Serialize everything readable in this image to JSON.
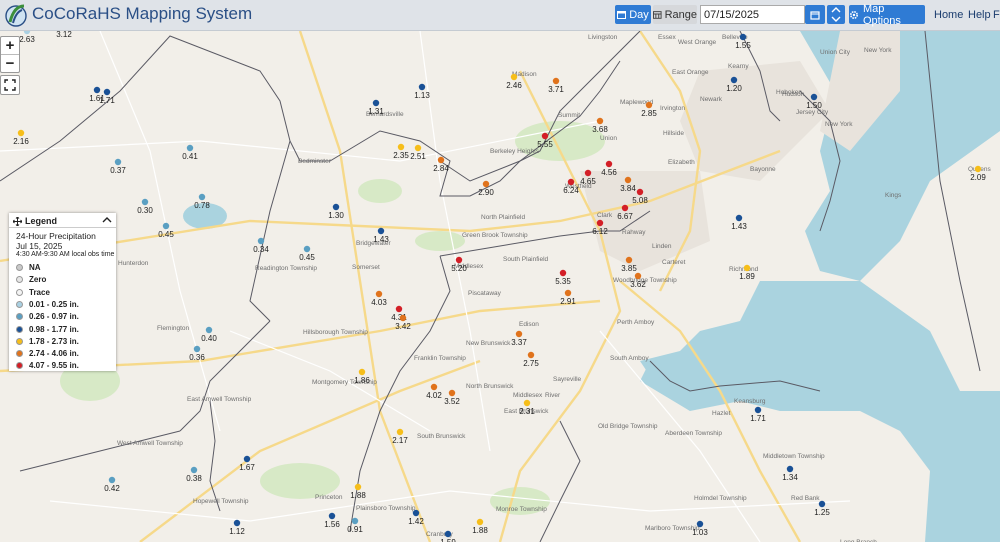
{
  "header": {
    "title": "CoCoRaHS Mapping System",
    "day_label": "Day",
    "range_label": "Range",
    "date_value": "07/15/2025",
    "map_options_label": "Map Options",
    "nav": [
      "Home",
      "Help",
      "Fe"
    ]
  },
  "map": {
    "labels": [
      {
        "t": "Essex"
      },
      {
        "t": "Livingston"
      },
      {
        "t": "West Orange"
      },
      {
        "t": "Belleville"
      },
      {
        "t": "East Orange"
      },
      {
        "t": "Union City"
      },
      {
        "t": "New York"
      },
      {
        "t": "Kearny"
      },
      {
        "t": "Newark"
      },
      {
        "t": "Irvington"
      },
      {
        "t": "Maplewood"
      },
      {
        "t": "Madison"
      },
      {
        "t": "Summit"
      },
      {
        "t": "Hoboken"
      },
      {
        "t": "Hudson"
      },
      {
        "t": "Jersey City"
      },
      {
        "t": "New York"
      },
      {
        "t": "Hillside"
      },
      {
        "t": "Union"
      },
      {
        "t": "Elizabeth"
      },
      {
        "t": "Bayonne"
      },
      {
        "t": "Bernardsville"
      },
      {
        "t": "Bedminster"
      },
      {
        "t": "Berkeley Heights"
      },
      {
        "t": "Westfield"
      },
      {
        "t": "Clark"
      },
      {
        "t": "Rahway"
      },
      {
        "t": "Linden"
      },
      {
        "t": "Kings"
      },
      {
        "t": "Queens"
      },
      {
        "t": "North Plainfield"
      },
      {
        "t": "Green Brook Township"
      },
      {
        "t": "Bridgewater"
      },
      {
        "t": "Somerset"
      },
      {
        "t": "Middlesex"
      },
      {
        "t": "South Plainfield"
      },
      {
        "t": "Hunterdon"
      },
      {
        "t": "Readington Township"
      },
      {
        "t": "Piscataway"
      },
      {
        "t": "Carteret"
      },
      {
        "t": "Woodbridge Township"
      },
      {
        "t": "Richmond"
      },
      {
        "t": "Hillsborough Township"
      },
      {
        "t": "Flemington"
      },
      {
        "t": "Edison"
      },
      {
        "t": "New Brunswick"
      },
      {
        "t": "Perth Amboy"
      },
      {
        "t": "South Amboy"
      },
      {
        "t": "Franklin Township"
      },
      {
        "t": "Sayreville"
      },
      {
        "t": "Montgomery Township"
      },
      {
        "t": "North Brunswick"
      },
      {
        "t": "Middlesex"
      },
      {
        "t": "East Brunswick"
      },
      {
        "t": "Keansburg"
      },
      {
        "t": "Hazlet"
      },
      {
        "t": "East Amwell Township"
      },
      {
        "t": "Old Bridge Township"
      },
      {
        "t": "Aberdeen Township"
      },
      {
        "t": "West Amwell Township"
      },
      {
        "t": "South Brunswick"
      },
      {
        "t": "Middletown Township"
      },
      {
        "t": "Princeton"
      },
      {
        "t": "Holmdel Township"
      },
      {
        "t": "Red Bank"
      },
      {
        "t": "Hopewell Township"
      },
      {
        "t": "Plainsboro Township"
      },
      {
        "t": "Monroe Township"
      },
      {
        "t": "Marlboro Township"
      },
      {
        "t": "Long Branch"
      },
      {
        "t": "Cranbury"
      },
      {
        "t": "River"
      }
    ],
    "stations": [
      {
        "v": "2.63",
        "c": "l1"
      },
      {
        "v": "3.12",
        "c": "o"
      },
      {
        "v": "1.55",
        "c": "d"
      },
      {
        "v": "1.61",
        "c": "d"
      },
      {
        "v": "1.71",
        "c": "d"
      },
      {
        "v": "2.46",
        "c": "y"
      },
      {
        "v": "3.71",
        "c": "o"
      },
      {
        "v": "1.20",
        "c": "d"
      },
      {
        "v": "1.50",
        "c": "d"
      },
      {
        "v": "1.13",
        "c": "d"
      },
      {
        "v": "1.31",
        "c": "d"
      },
      {
        "v": "2.85",
        "c": "o"
      },
      {
        "v": "3.68",
        "c": "o"
      },
      {
        "v": "2.16",
        "c": "y"
      },
      {
        "v": "5.55",
        "c": "r"
      },
      {
        "v": "0.41",
        "c": "l2"
      },
      {
        "v": "2.35",
        "c": "y"
      },
      {
        "v": "2.51",
        "c": "y"
      },
      {
        "v": "2.84",
        "c": "o"
      },
      {
        "v": "4.56",
        "c": "r"
      },
      {
        "v": "0.37",
        "c": "l2"
      },
      {
        "v": "4.65",
        "c": "r"
      },
      {
        "v": "6.24",
        "c": "r"
      },
      {
        "v": "3.84",
        "c": "o"
      },
      {
        "v": "5.08",
        "c": "r"
      },
      {
        "v": "2.09",
        "c": "y"
      },
      {
        "v": "2.90",
        "c": "o"
      },
      {
        "v": "0.78",
        "c": "l2"
      },
      {
        "v": "0.30",
        "c": "l2"
      },
      {
        "v": "1.30",
        "c": "d"
      },
      {
        "v": "6.67",
        "c": "r"
      },
      {
        "v": "0.45",
        "c": "l2"
      },
      {
        "v": "6.12",
        "c": "r"
      },
      {
        "v": "1.43",
        "c": "d"
      },
      {
        "v": "1.43",
        "c": "d"
      },
      {
        "v": "0.34",
        "c": "l2"
      },
      {
        "v": "0.45",
        "c": "l2"
      },
      {
        "v": "5.20",
        "c": "r"
      },
      {
        "v": "3.85",
        "c": "o"
      },
      {
        "v": "1.89",
        "c": "y"
      },
      {
        "v": "5.35",
        "c": "r"
      },
      {
        "v": "3.62",
        "c": "o"
      },
      {
        "v": "2.91",
        "c": "o"
      },
      {
        "v": "4.03",
        "c": "o"
      },
      {
        "v": "4.31",
        "c": "r"
      },
      {
        "v": "3.42",
        "c": "o"
      },
      {
        "v": "0.40",
        "c": "l2"
      },
      {
        "v": "3.37",
        "c": "o"
      },
      {
        "v": "0.36",
        "c": "l2"
      },
      {
        "v": "2.75",
        "c": "o"
      },
      {
        "v": "1.86",
        "c": "y"
      },
      {
        "v": "4.02",
        "c": "o"
      },
      {
        "v": "3.52",
        "c": "o"
      },
      {
        "v": "2.31",
        "c": "y"
      },
      {
        "v": "1.71",
        "c": "d"
      },
      {
        "v": "2.17",
        "c": "y"
      },
      {
        "v": "1.67",
        "c": "d"
      },
      {
        "v": "1.34",
        "c": "d"
      },
      {
        "v": "0.38",
        "c": "l2"
      },
      {
        "v": "0.42",
        "c": "l2"
      },
      {
        "v": "1.88",
        "c": "y"
      },
      {
        "v": "1.25",
        "c": "d"
      },
      {
        "v": "1.56",
        "c": "d"
      },
      {
        "v": "0.91",
        "c": "l2"
      },
      {
        "v": "1.42",
        "c": "d"
      },
      {
        "v": "1.88",
        "c": "y"
      },
      {
        "v": "1.12",
        "c": "d"
      },
      {
        "v": "1.03",
        "c": "d"
      },
      {
        "v": "1.59",
        "c": "d"
      }
    ]
  },
  "legend": {
    "title": "Legend",
    "subtitle": "24-Hour Precipitation",
    "date": "Jul 15, 2025",
    "obs_time": "4:30 AM-9:30 AM local obs time",
    "items": [
      {
        "label": "NA",
        "color": "#c9c9c9"
      },
      {
        "label": "Zero",
        "color": "#e6e6e6"
      },
      {
        "label": "Trace",
        "color": "#f4f4f4"
      },
      {
        "label": "0.01 - 0.25 in.",
        "color": "#a9d0e2"
      },
      {
        "label": "0.26 - 0.97 in.",
        "color": "#5a9fc2"
      },
      {
        "label": "0.98 - 1.77 in.",
        "color": "#1a5196"
      },
      {
        "label": "1.78 - 2.73 in.",
        "color": "#f6be1a"
      },
      {
        "label": "2.74 - 4.06 in.",
        "color": "#e0731c"
      },
      {
        "label": "4.07 - 9.55 in.",
        "color": "#d31f27"
      }
    ]
  },
  "colors": {
    "l1": "#a9d0e2",
    "l2": "#5a9fc2",
    "d": "#1a5196",
    "y": "#f6be1a",
    "o": "#e0731c",
    "r": "#d31f27",
    "accent": "#2f7bd4"
  }
}
